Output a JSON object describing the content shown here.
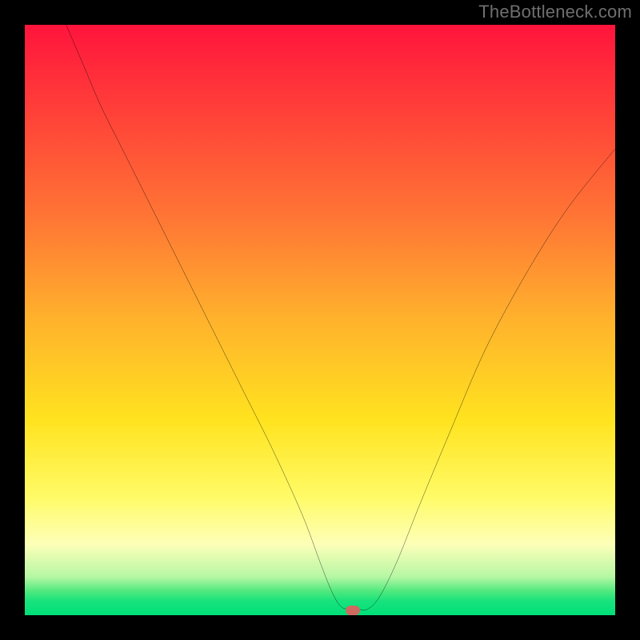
{
  "watermark": "TheBottleneck.com",
  "colors": {
    "page_bg": "#000000",
    "gradient_top": "#ff143c",
    "gradient_bottom": "#00e07a",
    "curve": "#000000",
    "marker": "#cf6a60",
    "watermark_text": "#6f6f6f"
  },
  "chart_data": {
    "type": "line",
    "title": "",
    "xlabel": "",
    "ylabel": "",
    "xlim": [
      0,
      100
    ],
    "ylim": [
      0,
      100
    ],
    "grid": false,
    "series": [
      {
        "name": "bottleneck-curve",
        "x": [
          7,
          10,
          13,
          17,
          22,
          27,
          32,
          37,
          42,
          47,
          50,
          52,
          53.5,
          55,
          56.5,
          58,
          60,
          63,
          67,
          72,
          78,
          85,
          92,
          100
        ],
        "y": [
          100,
          93,
          86,
          78,
          68,
          58,
          48,
          38,
          28,
          17,
          9,
          4,
          1.5,
          1,
          1,
          1,
          3,
          9,
          19,
          31,
          45,
          58,
          69,
          79
        ]
      }
    ],
    "annotations": [
      {
        "name": "min-marker",
        "x": 55.5,
        "y": 0.8
      }
    ]
  }
}
